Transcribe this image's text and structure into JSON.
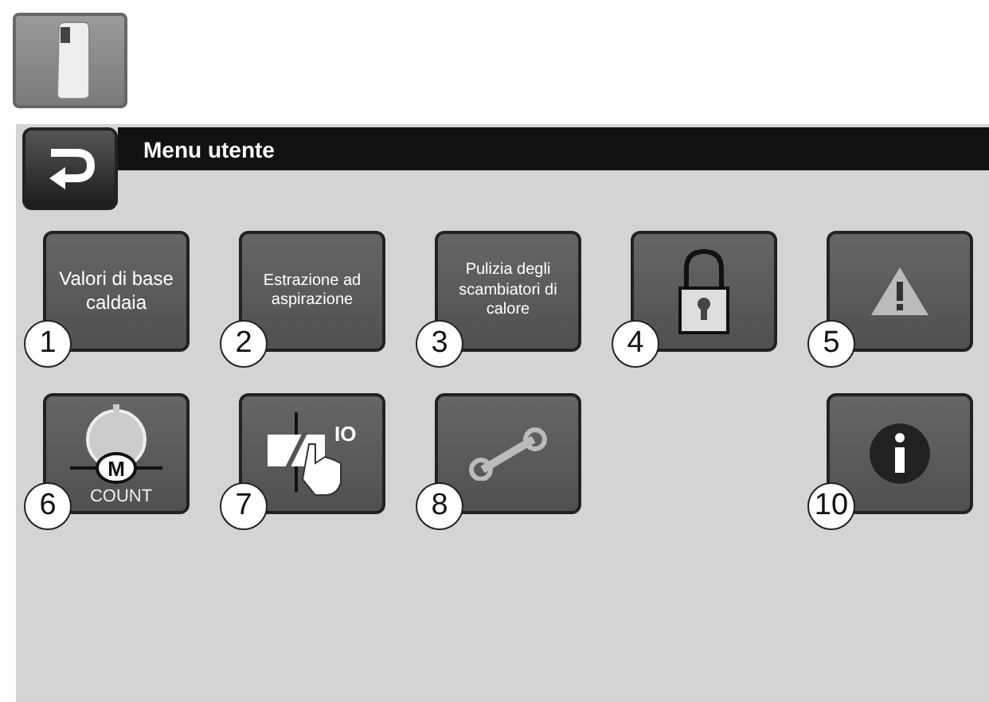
{
  "header": {
    "title": "Menu utente"
  },
  "rows": [
    [
      {
        "kind": "text",
        "label": "Valori di base caldaia",
        "number": "1",
        "small": false
      },
      {
        "kind": "text",
        "label": "Estrazione ad aspirazione",
        "number": "2",
        "small": true
      },
      {
        "kind": "text",
        "label": "Pulizia degli scambiatori di calore",
        "number": "3",
        "small": true
      },
      {
        "kind": "lock",
        "number": "4"
      },
      {
        "kind": "warning",
        "number": "5"
      }
    ],
    [
      {
        "kind": "counter",
        "number": "6",
        "icon_texts": [
          "M",
          "COUNT"
        ]
      },
      {
        "kind": "relay",
        "number": "7",
        "icon_texts": [
          "IO"
        ]
      },
      {
        "kind": "wrench",
        "number": "8"
      },
      {
        "kind": "info",
        "number": "10"
      }
    ]
  ]
}
